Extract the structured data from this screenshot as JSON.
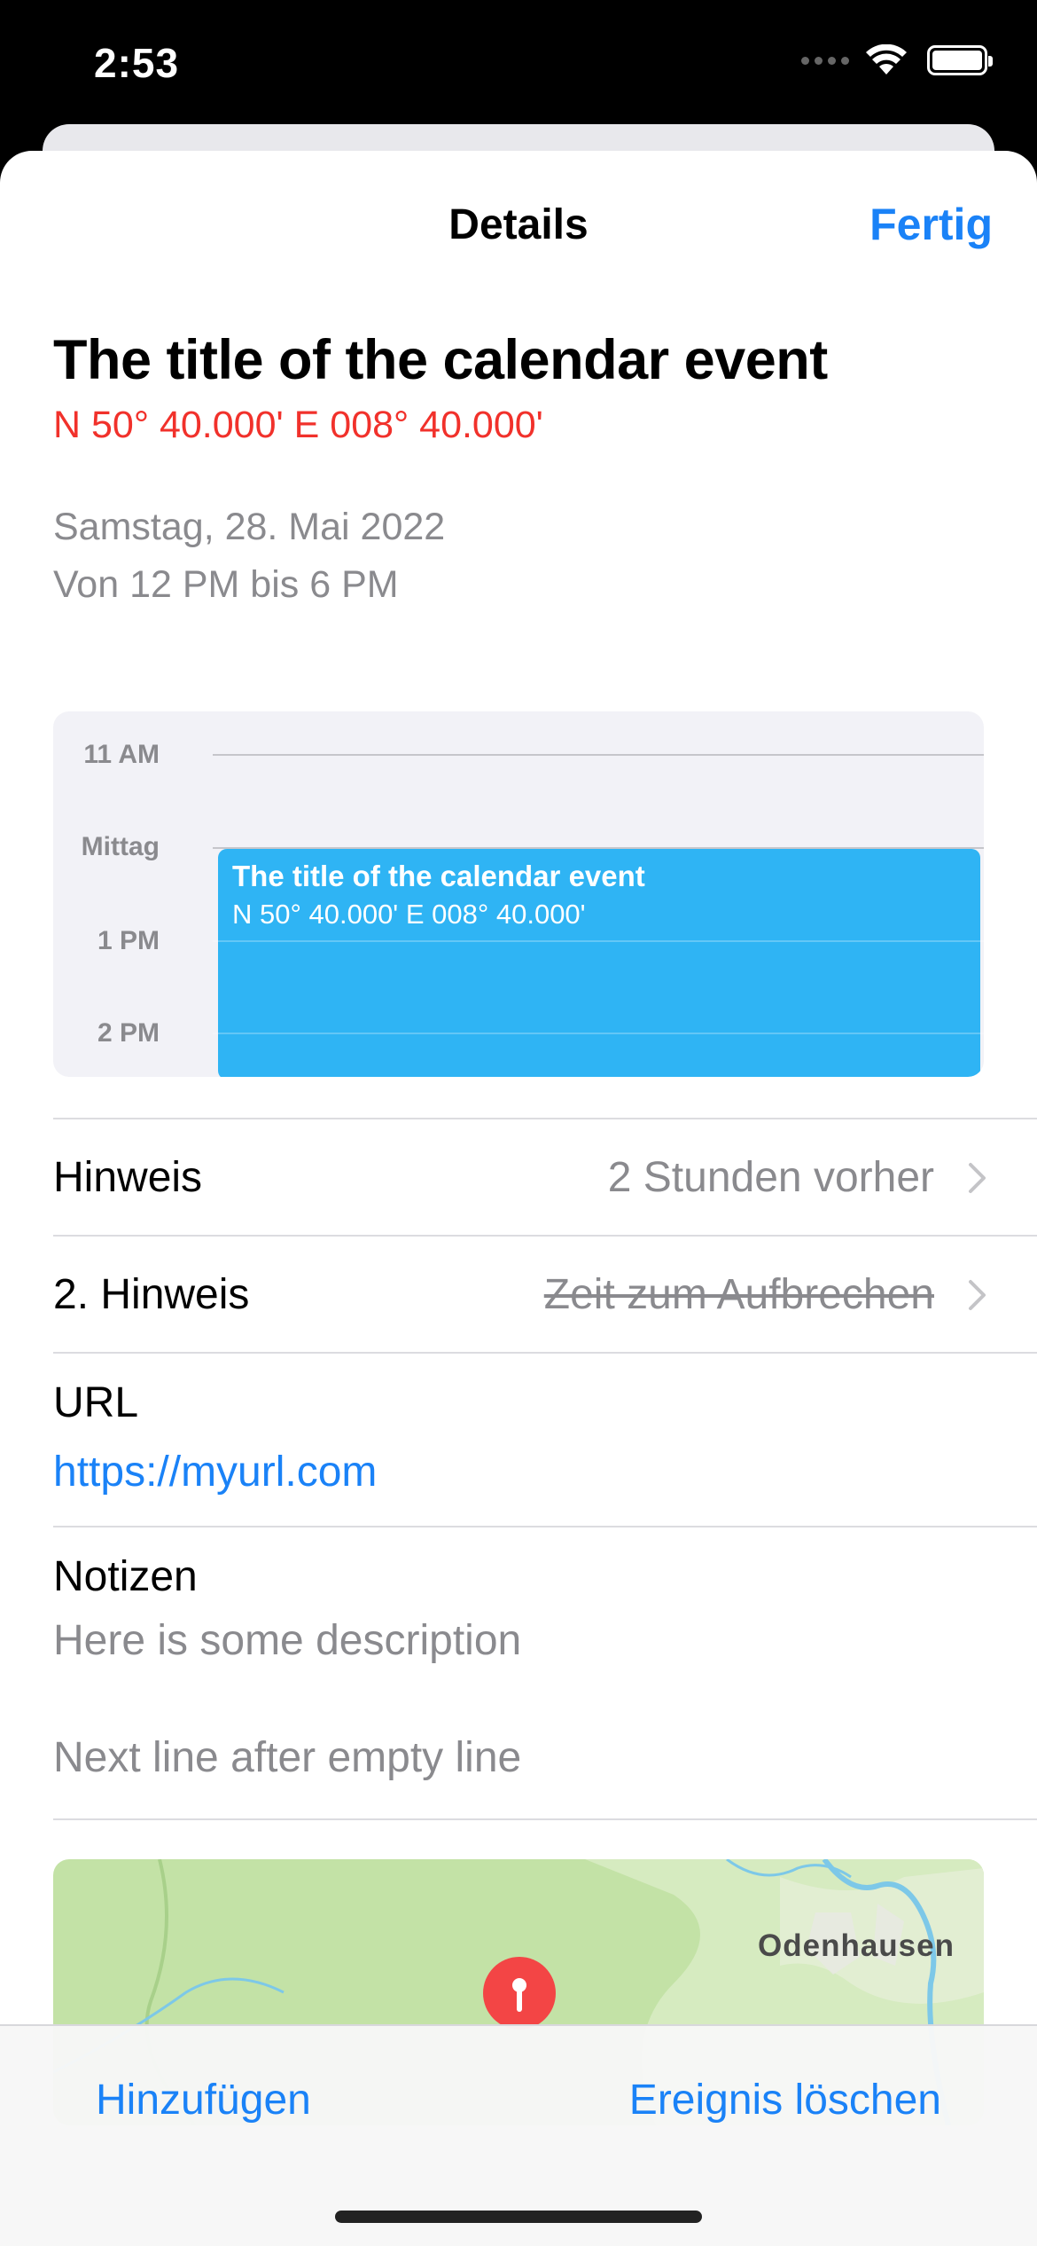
{
  "status_bar": {
    "time": "2:53"
  },
  "nav": {
    "title": "Details",
    "done_label": "Fertig"
  },
  "event": {
    "title": "The title of the calendar event",
    "location": "N 50° 40.000' E 008° 40.000'",
    "date": "Samstag, 28. Mai 2022",
    "time_range": "Von 12 PM bis 6 PM"
  },
  "day_view": {
    "hours": [
      "11 AM",
      "Mittag",
      "1 PM",
      "2 PM"
    ],
    "event_block": {
      "title": "The title of the calendar event",
      "location": "N 50° 40.000' E 008° 40.000'"
    }
  },
  "alerts": {
    "alert_label": "Hinweis",
    "alert_value": "2 Stunden vorher",
    "second_alert_label": "2. Hinweis",
    "second_alert_value": "Zeit zum Aufbrechen"
  },
  "url": {
    "label": "URL",
    "value": "https://myurl.com"
  },
  "notes": {
    "label": "Notizen",
    "line1": "Here is some description",
    "line2": "Next line after empty line"
  },
  "map": {
    "town": "Odenhausen"
  },
  "toolbar": {
    "add_label": "Hinzufügen",
    "delete_label": "Ereignis löschen"
  },
  "colors": {
    "accent": "#1a82f7",
    "location_red": "#f1312b",
    "event_blue": "#2fb4f4"
  }
}
